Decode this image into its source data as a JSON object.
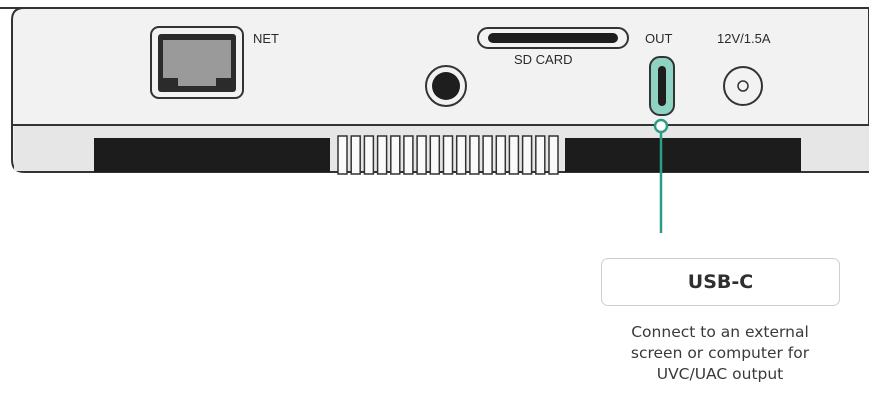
{
  "device": {
    "ports": {
      "net_label": "NET",
      "sd_card_label": "SD CARD",
      "out_label": "OUT",
      "power_label": "12V/1.5A"
    }
  },
  "callout": {
    "title": "USB-C",
    "description_lines": [
      "Connect to an external",
      "screen or computer for",
      "UVC/UAC output"
    ]
  },
  "colors": {
    "accent": "#2a9d86",
    "usbc_fill": "#8fd3c3",
    "body_panel": "#f2f2f2",
    "outline": "#333333",
    "vent_bar": "#1c1c1c"
  }
}
